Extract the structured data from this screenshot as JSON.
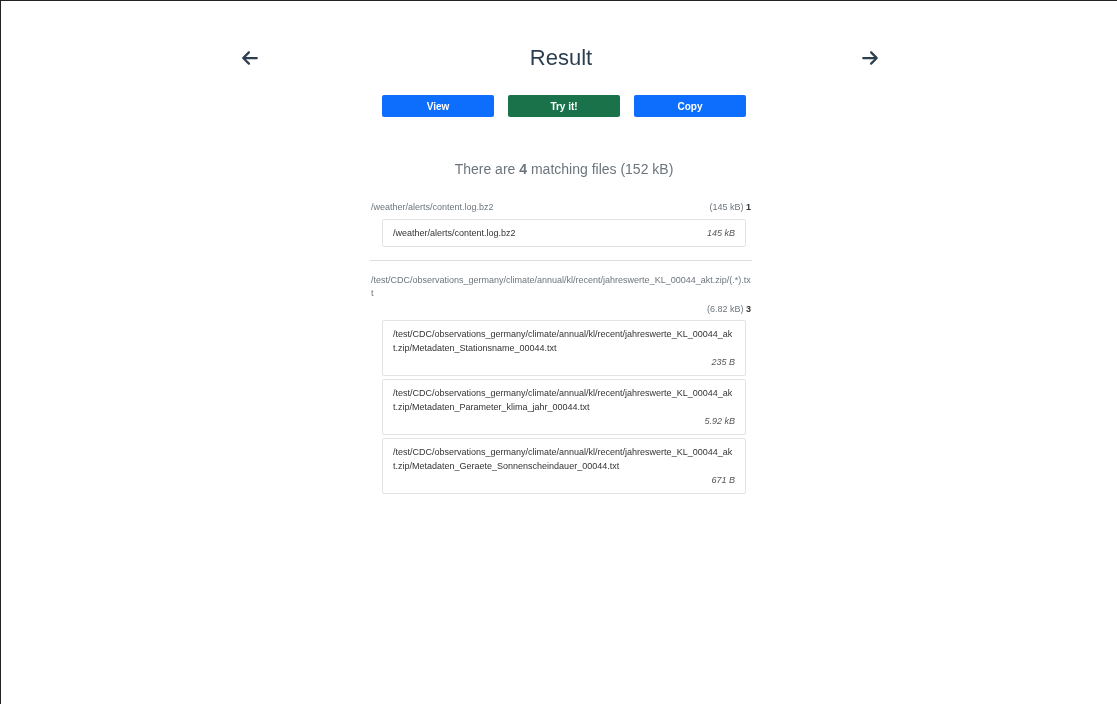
{
  "title": "Result",
  "buttons": [
    {
      "label": "View",
      "kind": "primary"
    },
    {
      "label": "Try it!",
      "kind": "success"
    },
    {
      "label": "Copy",
      "kind": "primary"
    }
  ],
  "summary": "There are **4** matching files (152 kB)",
  "groups": [
    {
      "path": "/weather/alerts/content.log.bz2",
      "size": "(145 kB)",
      "count": "1",
      "files": [
        {
          "path": "/weather/alerts/content.log.bz2",
          "size": "145 kB"
        }
      ]
    },
    {
      "path": "/test/CDC/observations_germany/climate/annual/kl/recent/jahreswerte_KL_00044_akt.zip/(.*).txt",
      "size": "(6.82 kB)",
      "count": "3",
      "files": [
        {
          "path": "/test/CDC/observations_germany/climate/annual/kl/recent/jahreswerte_KL_00044_akt.zip/Metadaten_Stationsname_00044.txt",
          "size": "235 B"
        },
        {
          "path": "/test/CDC/observations_germany/climate/annual/kl/recent/jahreswerte_KL_00044_akt.zip/Metadaten_Parameter_klima_jahr_00044.txt",
          "size": "5.92 kB"
        },
        {
          "path": "/test/CDC/observations_germany/climate/annual/kl/recent/jahreswerte_KL_00044_akt.zip/Metadaten_Geraete_Sonnenscheindauer_00044.txt",
          "size": "671 B"
        }
      ]
    }
  ]
}
